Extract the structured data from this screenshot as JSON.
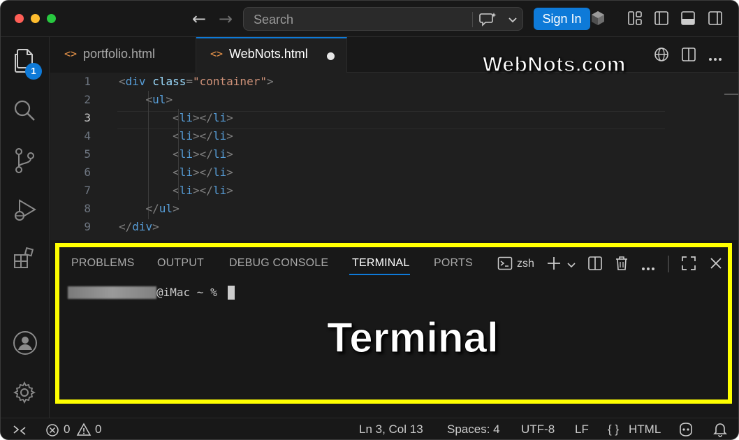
{
  "titlebar": {
    "search_placeholder": "Search",
    "signin_label": "Sign In",
    "back_arrow": "←",
    "forward_arrow": "→"
  },
  "activity": {
    "explorer_badge": "1"
  },
  "tabs": [
    {
      "label": "portfolio.html",
      "icon": "<>"
    },
    {
      "label": "WebNots.html",
      "icon": "<>"
    }
  ],
  "editor": {
    "lines": [
      {
        "n": "1"
      },
      {
        "n": "2"
      },
      {
        "n": "3"
      },
      {
        "n": "4"
      },
      {
        "n": "5"
      },
      {
        "n": "6"
      },
      {
        "n": "7"
      },
      {
        "n": "8"
      },
      {
        "n": "9"
      }
    ],
    "active_line": "3",
    "watermark": "WebNots.com"
  },
  "panel": {
    "tabs": [
      "PROBLEMS",
      "OUTPUT",
      "DEBUG CONSOLE",
      "TERMINAL",
      "PORTS"
    ],
    "active_tab": "TERMINAL",
    "shell": "zsh",
    "prompt": "@iMac ~ %",
    "caption": "Terminal"
  },
  "status": {
    "errors": "0",
    "warnings": "0",
    "position": "Ln 3, Col 13",
    "spaces": "Spaces: 4",
    "encoding": "UTF-8",
    "eol": "LF",
    "language_braces": "{ }",
    "language": "HTML"
  },
  "colors": {
    "accent": "#0e7ad8",
    "highlight_border": "#ffff00",
    "tag": "#569cd6",
    "attribute": "#9cdcfe",
    "string": "#ce9178"
  }
}
